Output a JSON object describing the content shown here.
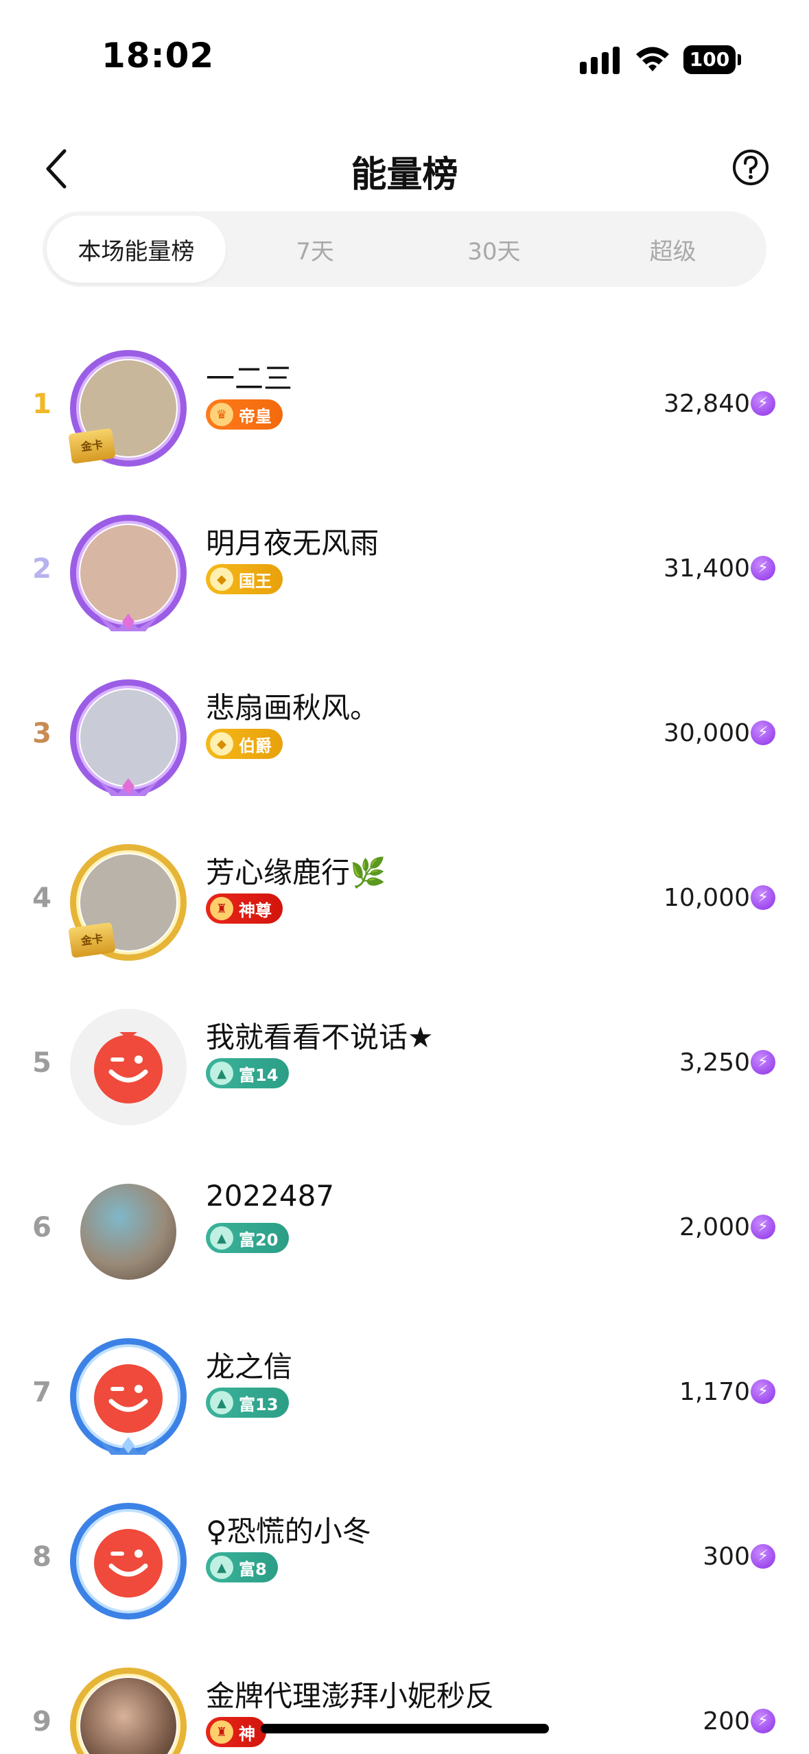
{
  "status_bar": {
    "time": "18:02",
    "battery": "100"
  },
  "header": {
    "title": "能量榜"
  },
  "tabs": [
    {
      "label": "本场能量榜",
      "active": true
    },
    {
      "label": "7天",
      "active": false
    },
    {
      "label": "30天",
      "active": false
    },
    {
      "label": "超级",
      "active": false
    }
  ],
  "ranking": [
    {
      "rank": "1",
      "name": "一二三",
      "badge": "帝皇",
      "score": "32,840",
      "avatar_color": "#c9b79c",
      "frame": "purple",
      "card": "金卡"
    },
    {
      "rank": "2",
      "name": "明月夜无风雨",
      "badge": "国王",
      "score": "31,400",
      "avatar_color": "#d8b6a4",
      "frame": "purple",
      "card": ""
    },
    {
      "rank": "3",
      "name": "悲扇画秋风。",
      "badge": "伯爵",
      "score": "30,000",
      "avatar_color": "#c9ccd6",
      "frame": "purple",
      "card": ""
    },
    {
      "rank": "4",
      "name": "芳心缘鹿行🌿",
      "badge": "神尊",
      "score": "10,000",
      "avatar_color": "#b9b3aa",
      "frame": "gold",
      "card": "金卡"
    },
    {
      "rank": "5",
      "name": "我就看看不说话★",
      "badge": "富14",
      "score": "3,250",
      "avatar_color": "#ef4a3b",
      "frame": "none",
      "card": ""
    },
    {
      "rank": "6",
      "name": "2022487",
      "badge": "富20",
      "score": "2,000",
      "avatar_color": "#9a8a78",
      "frame": "none",
      "card": ""
    },
    {
      "rank": "7",
      "name": "龙之信",
      "badge": "富13",
      "score": "1,170",
      "avatar_color": "#ef4a3b",
      "frame": "blue",
      "card": ""
    },
    {
      "rank": "8",
      "name": "♀恐慌的小冬",
      "badge": "富8",
      "score": "300",
      "avatar_color": "#ef4a3b",
      "frame": "blue",
      "card": ""
    },
    {
      "rank": "9",
      "name": "金牌代理澎拜小妮秒反",
      "badge": "神",
      "score": "200",
      "avatar_color": "#7a5a48",
      "frame": "gold",
      "card": ""
    }
  ]
}
